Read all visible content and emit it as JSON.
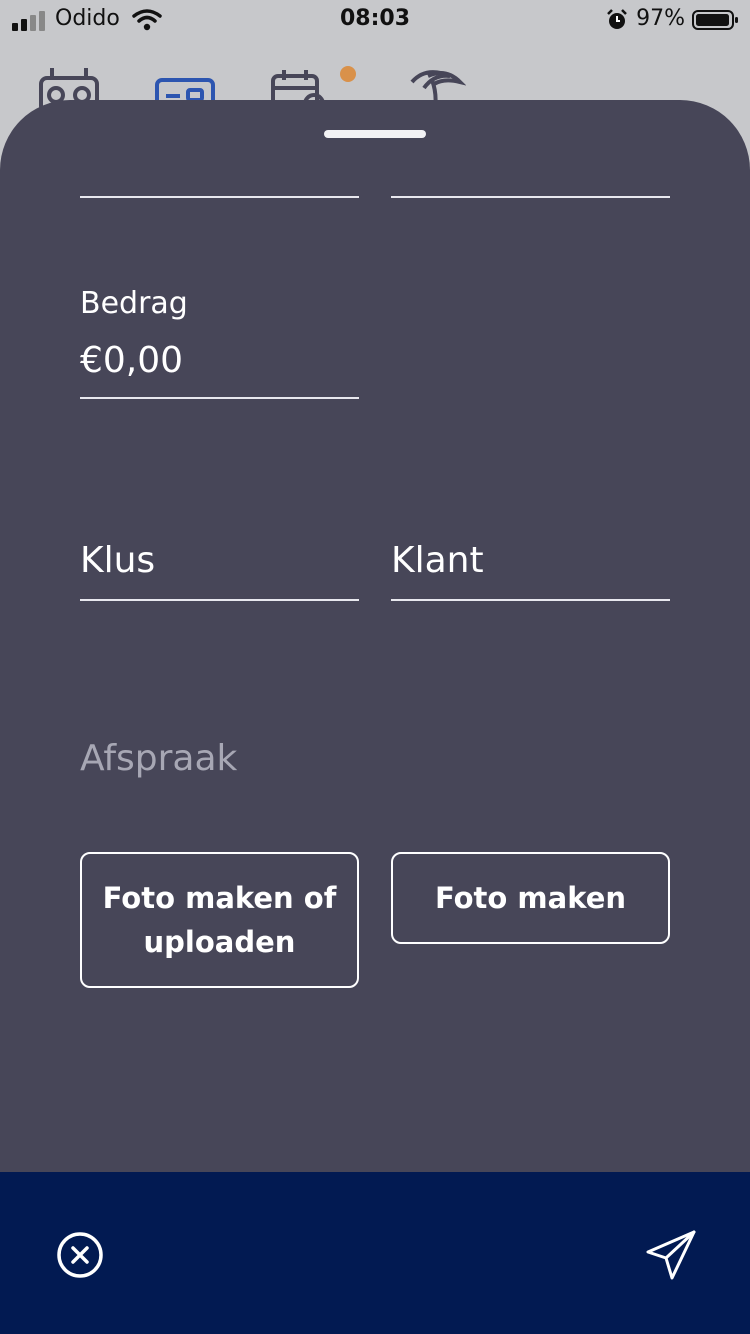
{
  "status_bar": {
    "carrier": "Odido",
    "time": "08:03",
    "battery_percent": "97%",
    "icons": [
      "signal-icon",
      "wifi-icon",
      "alarm-icon",
      "battery-icon"
    ]
  },
  "tabs": {
    "icons": [
      "radio-icon",
      "id-card-icon",
      "calendar-icon",
      "palm-tree-icon"
    ],
    "notification_dot_color": "#d9914a"
  },
  "form": {
    "amount_label": "Bedrag",
    "amount_value": "€0,00",
    "job_placeholder": "Klus",
    "client_placeholder": "Klant",
    "appointment_placeholder": "Afspraak",
    "photo_upload_button": "Foto maken of uploaden",
    "photo_button": "Foto maken"
  },
  "bottom_bar": {
    "close_icon": "close-circle-icon",
    "send_icon": "paper-plane-icon"
  },
  "colors": {
    "sheet": "#474658",
    "bottom_bar": "#021a52",
    "accent_dot": "#d9914a"
  }
}
